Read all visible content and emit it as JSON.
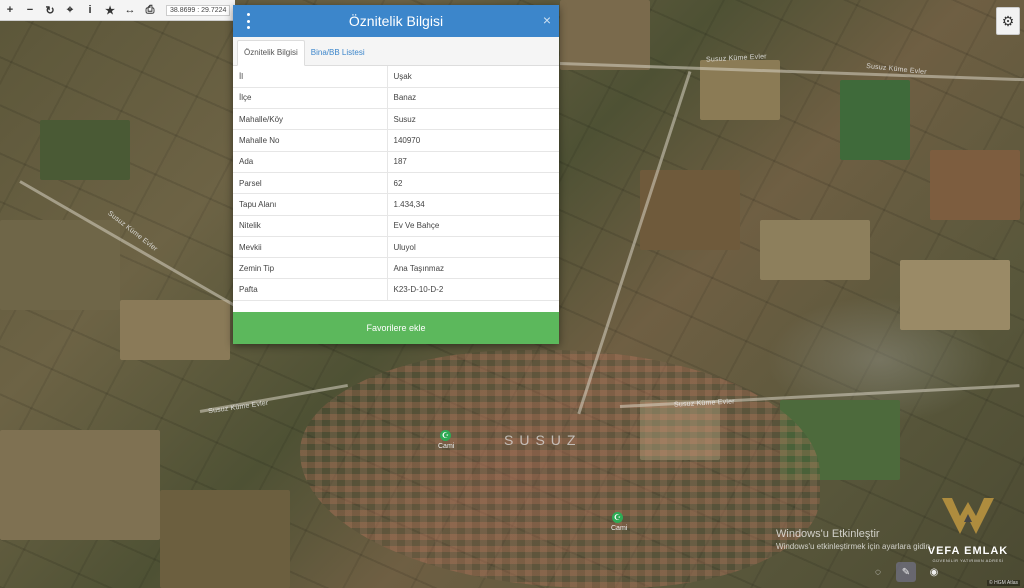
{
  "toolbar": {
    "buttons": [
      {
        "name": "zoom-in-icon",
        "glyph": "+"
      },
      {
        "name": "zoom-out-icon",
        "glyph": "−"
      },
      {
        "name": "refresh-icon",
        "glyph": "↻"
      },
      {
        "name": "locate-icon",
        "glyph": "⌖"
      },
      {
        "name": "info-icon",
        "glyph": "i"
      },
      {
        "name": "star-icon",
        "glyph": "★"
      },
      {
        "name": "measure-icon",
        "glyph": "↔"
      },
      {
        "name": "print-icon",
        "glyph": "⎙"
      }
    ],
    "coordinates": "38.8699 : 29.7224"
  },
  "settings": {
    "glyph": "⚙"
  },
  "panel": {
    "title": "Öznitelik Bilgisi",
    "close_glyph": "×",
    "tabs": [
      {
        "label": "Öznitelik Bilgisi",
        "active": true
      },
      {
        "label": "Bina/BB Listesi",
        "active": false
      }
    ],
    "rows": [
      {
        "key": "İl",
        "value": "Uşak"
      },
      {
        "key": "İlçe",
        "value": "Banaz"
      },
      {
        "key": "Mahalle/Köy",
        "value": "Susuz"
      },
      {
        "key": "Mahalle No",
        "value": "140970"
      },
      {
        "key": "Ada",
        "value": "187"
      },
      {
        "key": "Parsel",
        "value": "62"
      },
      {
        "key": "Tapu Alanı",
        "value": "1.434,34"
      },
      {
        "key": "Nitelik",
        "value": "Ev Ve Bahçe"
      },
      {
        "key": "Mevkii",
        "value": "Uluyol"
      },
      {
        "key": "Zemin Tip",
        "value": "Ana Taşınmaz"
      },
      {
        "key": "Pafta",
        "value": "K23-D-10-D-2"
      }
    ],
    "favorite_label": "Favorilere ekle",
    "accent_color": "#3c86cb",
    "button_color": "#5cb85c"
  },
  "map": {
    "labels": [
      {
        "text": "Susuz Küme Evler",
        "pos": "top-right road"
      },
      {
        "text": "Susuz Küme Evler",
        "pos": "top-middle road"
      },
      {
        "text": "Susuz Küme Evler",
        "pos": "left road"
      },
      {
        "text": "Susuz Küme Evler",
        "pos": "lower-left road"
      },
      {
        "text": "Susuz Küme Evler",
        "pos": "right road"
      }
    ],
    "town": "SUSUZ",
    "poi": [
      {
        "label": "Cami"
      },
      {
        "label": "Cami"
      }
    ],
    "attribution": "© HGM Atlas"
  },
  "watermark": {
    "windows_line1": "Windows'u Etkinleştir",
    "windows_line2": "Windows'u etkinleştirmek için ayarlara gidin.",
    "brand_name": "VEFA EMLAK",
    "brand_tagline": "GÜVENİLİR YATIRIMIN ADRESİ"
  }
}
